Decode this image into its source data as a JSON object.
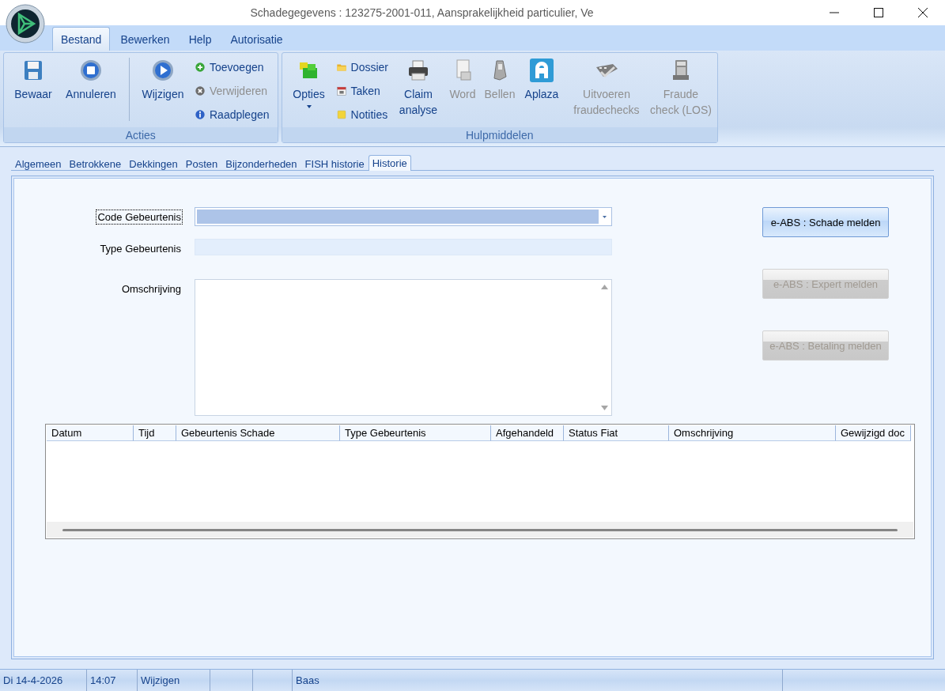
{
  "window": {
    "title": "Schadegegevens : 123275-2001-011, Aansprakelijkheid particulier, Ve"
  },
  "menu_tabs": [
    {
      "label": "Bestand",
      "selected": true
    },
    {
      "label": "Bewerken",
      "selected": false
    },
    {
      "label": "Help",
      "selected": false
    },
    {
      "label": "Autorisatie",
      "selected": false
    }
  ],
  "ribbon": {
    "groups": [
      {
        "title": "Acties",
        "items": [
          {
            "kind": "large",
            "label": "Bewaar",
            "disabled": false
          },
          {
            "kind": "large",
            "label": "Annuleren",
            "disabled": false
          },
          {
            "kind": "separator"
          },
          {
            "kind": "large",
            "label": "Wijzigen",
            "disabled": false
          },
          {
            "kind": "stack",
            "items": [
              {
                "label": "Toevoegen",
                "disabled": false
              },
              {
                "label": "Verwijderen",
                "disabled": true
              },
              {
                "label": "Raadplegen",
                "disabled": false
              }
            ]
          }
        ]
      },
      {
        "title": "Hulpmiddelen",
        "items": [
          {
            "kind": "large",
            "label": "Opties",
            "disabled": false,
            "dropdown": true
          },
          {
            "kind": "stack",
            "items": [
              {
                "label": "Dossier",
                "disabled": false
              },
              {
                "label": "Taken",
                "disabled": false
              },
              {
                "label": "Notities",
                "disabled": false
              }
            ]
          },
          {
            "kind": "large",
            "label": "Claim analyse",
            "disabled": false
          },
          {
            "kind": "large",
            "label": "Word",
            "disabled": true
          },
          {
            "kind": "large",
            "label": "Bellen",
            "disabled": true
          },
          {
            "kind": "large",
            "label": "Aplaza",
            "disabled": false
          },
          {
            "kind": "large",
            "label": "Uitvoeren fraudechecks",
            "disabled": true
          },
          {
            "kind": "large",
            "label": "Fraude check (LOS)",
            "disabled": true
          }
        ]
      }
    ]
  },
  "tabs": [
    {
      "label": "Algemeen",
      "selected": false
    },
    {
      "label": "Betrokkene",
      "selected": false
    },
    {
      "label": "Dekkingen",
      "selected": false
    },
    {
      "label": "Posten",
      "selected": false
    },
    {
      "label": "Bijzonderheden",
      "selected": false
    },
    {
      "label": "FISH historie",
      "selected": false
    },
    {
      "label": "Historie",
      "selected": true
    }
  ],
  "form": {
    "fields": [
      {
        "kind": "combo",
        "label": "Code Gebeurtenis",
        "focused": true
      },
      {
        "kind": "text",
        "label": "Type Gebeurtenis",
        "focused": false
      },
      {
        "kind": "memo",
        "label": "Omschrijving",
        "focused": false
      }
    ]
  },
  "actions": [
    {
      "label": "e-ABS : Schade melden",
      "disabled": false
    },
    {
      "label": "e-ABS : Expert melden",
      "disabled": true
    },
    {
      "label": "e-ABS : Betaling melden",
      "disabled": true
    }
  ],
  "table": {
    "columns": [
      "Datum",
      "Tijd",
      "Gebeurtenis Schade",
      "Type Gebeurtenis",
      "Afgehandeld",
      "Status Fiat",
      "Omschrijving",
      "Gewijzigd doc"
    ]
  },
  "status_bar": [
    {
      "text": "Di 14-4-2026"
    },
    {
      "text": "14:07"
    },
    {
      "text": "Wijzigen"
    },
    {
      "text": "Baas"
    }
  ]
}
